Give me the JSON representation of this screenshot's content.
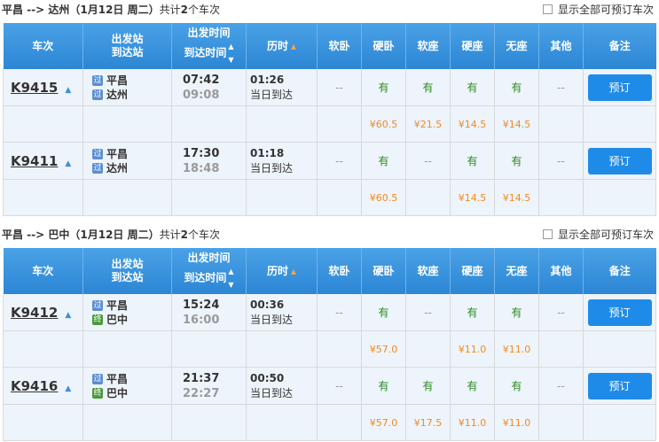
{
  "header_columns": [
    "车次",
    "出发站\n到达站",
    "出发时间\n到达时间",
    "历时",
    "软卧",
    "硬卧",
    "软座",
    "硬座",
    "无座",
    "其他",
    "备注"
  ],
  "book_label": "预订",
  "sections": [
    {
      "route": "平昌 --> 达州（1月12日  周二）",
      "count_prefix": "共计",
      "count": "2",
      "count_suffix": "个车次",
      "show_all": "显示全部可预订车次",
      "trains": [
        {
          "code": "K9415",
          "from": "平昌",
          "from_badge": "过",
          "to": "达州",
          "to_badge": "过",
          "depart": "07:42",
          "arrive": "09:08",
          "duration": "01:26",
          "arrive_day": "当日到达",
          "seats": [
            "--",
            "有",
            "有",
            "有",
            "有",
            "--"
          ],
          "prices": [
            "",
            "¥60.5",
            "¥21.5",
            "¥14.5",
            "¥14.5",
            ""
          ]
        },
        {
          "code": "K9411",
          "from": "平昌",
          "from_badge": "过",
          "to": "达州",
          "to_badge": "过",
          "depart": "17:30",
          "arrive": "18:48",
          "duration": "01:18",
          "arrive_day": "当日到达",
          "seats": [
            "--",
            "有",
            "--",
            "有",
            "有",
            "--"
          ],
          "prices": [
            "",
            "¥60.5",
            "",
            "¥14.5",
            "¥14.5",
            ""
          ]
        }
      ]
    },
    {
      "route": "平昌 --> 巴中（1月12日  周二）",
      "count_prefix": "共计",
      "count": "2",
      "count_suffix": "个车次",
      "show_all": "显示全部可预订车次",
      "trains": [
        {
          "code": "K9412",
          "from": "平昌",
          "from_badge": "过",
          "to": "巴中",
          "to_badge": "终",
          "depart": "15:24",
          "arrive": "16:00",
          "duration": "00:36",
          "arrive_day": "当日到达",
          "seats": [
            "--",
            "有",
            "--",
            "有",
            "有",
            "--"
          ],
          "prices": [
            "",
            "¥57.0",
            "",
            "¥11.0",
            "¥11.0",
            ""
          ]
        },
        {
          "code": "K9416",
          "from": "平昌",
          "from_badge": "过",
          "to": "巴中",
          "to_badge": "终",
          "depart": "21:37",
          "arrive": "22:27",
          "duration": "00:50",
          "arrive_day": "当日到达",
          "seats": [
            "--",
            "有",
            "有",
            "有",
            "有",
            "--"
          ],
          "prices": [
            "",
            "¥57.0",
            "¥17.5",
            "¥11.0",
            "¥11.0",
            ""
          ]
        }
      ]
    }
  ]
}
